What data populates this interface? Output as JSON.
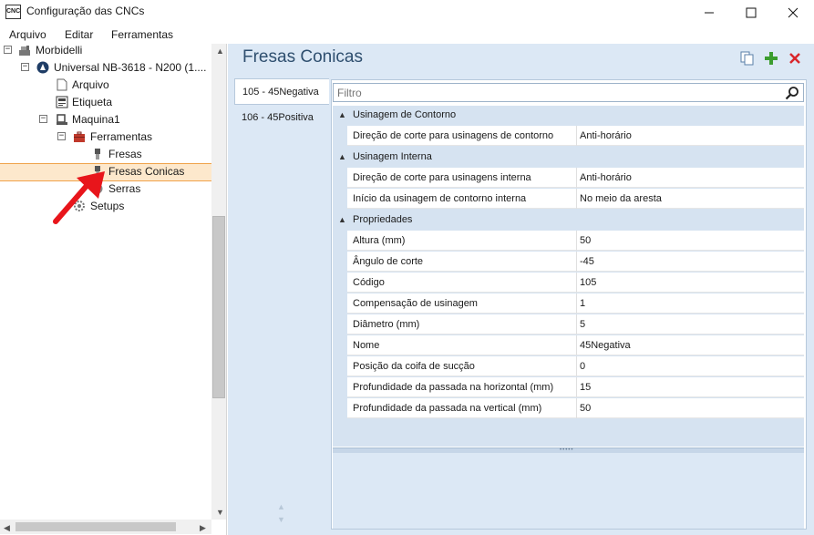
{
  "window": {
    "icon_text": "CNC",
    "title": "Configuração das CNCs"
  },
  "menu": [
    "Arquivo",
    "Editar",
    "Ferramentas"
  ],
  "tree": {
    "items": [
      {
        "label": "Morbidelli",
        "icon": "machine-icon"
      },
      {
        "label": "Universal NB-3618 - N200 (1....",
        "icon": "cnc-logo-icon"
      },
      {
        "label": "Arquivo",
        "icon": "file-icon"
      },
      {
        "label": "Etiqueta",
        "icon": "label-icon"
      },
      {
        "label": "Maquina1",
        "icon": "machine-icon"
      },
      {
        "label": "Ferramentas",
        "icon": "toolbox-icon"
      },
      {
        "label": "Fresas",
        "icon": "mill-icon"
      },
      {
        "label": "Fresas Conicas",
        "icon": "conical-mill-icon"
      },
      {
        "label": "Serras",
        "icon": "saw-icon"
      },
      {
        "label": "Setups",
        "icon": "gear-icon"
      }
    ],
    "selected": "Fresas Conicas"
  },
  "panel": {
    "title": "Fresas Conicas",
    "tools": [
      "copy-icon",
      "add-icon",
      "delete-icon"
    ]
  },
  "tool_list": [
    "105 - 45Negativa",
    "106 - 45Positiva"
  ],
  "filter": {
    "placeholder": "Filtro"
  },
  "categories": [
    {
      "label": "Usinagem de Contorno",
      "props": [
        {
          "name": "Direção de corte para usinagens de contorno",
          "value": "Anti-horário"
        }
      ]
    },
    {
      "label": "Usinagem Interna",
      "props": [
        {
          "name": "Direção de corte para usinagens interna",
          "value": "Anti-horário"
        },
        {
          "name": "Início da usinagem de contorno interna",
          "value": "No meio da aresta"
        }
      ]
    },
    {
      "label": "Propriedades",
      "props": [
        {
          "name": "Altura (mm)",
          "value": "50"
        },
        {
          "name": "Ângulo de corte",
          "value": "-45"
        },
        {
          "name": "Código",
          "value": "105"
        },
        {
          "name": "Compensação de usinagem",
          "value": "1"
        },
        {
          "name": "Diâmetro (mm)",
          "value": "5"
        },
        {
          "name": "Nome",
          "value": "45Negativa"
        },
        {
          "name": "Posição da coifa de sucção",
          "value": "0"
        },
        {
          "name": "Profundidade da passada na horizontal (mm)",
          "value": "15"
        },
        {
          "name": "Profundidade da passada na vertical (mm)",
          "value": "50"
        }
      ]
    }
  ],
  "colors": {
    "selection_bg": "#fde8cc",
    "selection_border": "#f0a24a",
    "panel_bg": "#dce8f5",
    "annotation_arrow": "#e8151b"
  }
}
